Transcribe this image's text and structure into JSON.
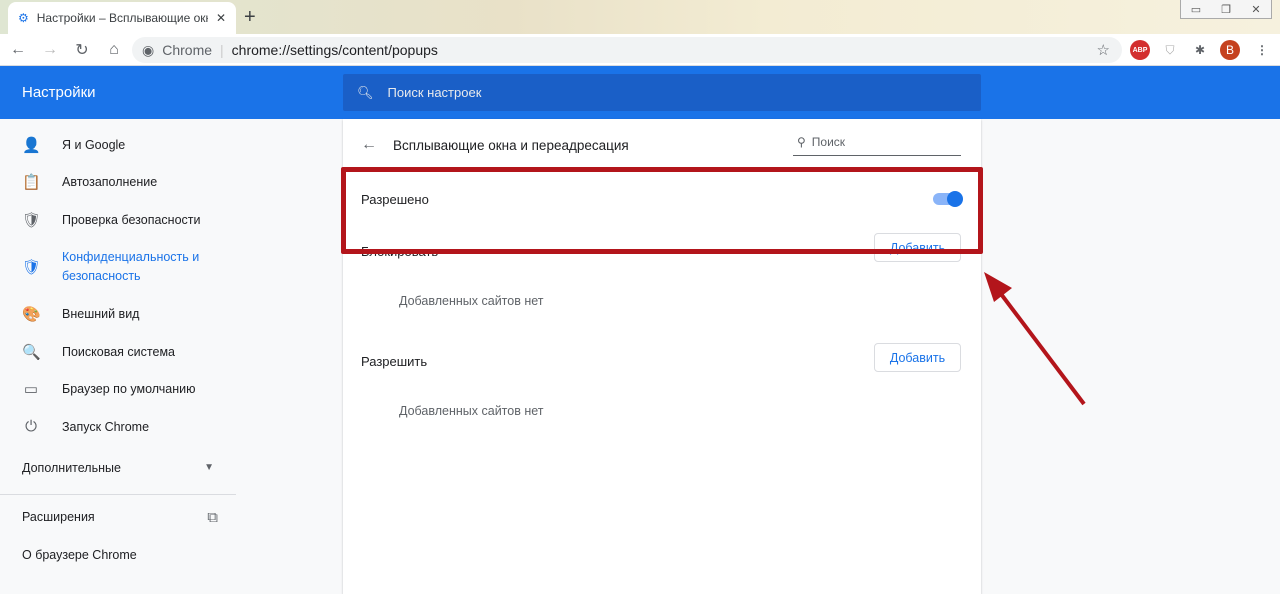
{
  "browser": {
    "tab_title": "Настройки – Всплывающие окна",
    "url_host": "Chrome",
    "url": "chrome://settings/content/popups",
    "avatar_letter": "B",
    "abp_label": "ABP"
  },
  "header": {
    "title": "Настройки",
    "search_placeholder": "Поиск настроек"
  },
  "sidebar": {
    "items": [
      {
        "label": "Я и Google",
        "icon": "👤"
      },
      {
        "label": "Автозаполнение",
        "icon": "📋"
      },
      {
        "label": "Проверка безопасности",
        "icon": "🛡"
      },
      {
        "label": "Конфиденциальность и безопасность",
        "icon": "🛡"
      },
      {
        "label": "Внешний вид",
        "icon": "🎨"
      },
      {
        "label": "Поисковая система",
        "icon": "🔍"
      },
      {
        "label": "Браузер по умолчанию",
        "icon": "▭"
      },
      {
        "label": "Запуск Chrome",
        "icon": "⏻"
      }
    ],
    "advanced": "Дополнительные",
    "extensions": "Расширения",
    "about": "О браузере Chrome"
  },
  "page": {
    "title": "Всплывающие окна и переадресация",
    "search_placeholder": "Поиск",
    "allowed_label": "Разрешено",
    "allowed_on": true,
    "block": {
      "label": "Блокировать",
      "add": "Добавить",
      "empty": "Добавленных сайтов нет"
    },
    "allow": {
      "label": "Разрешить",
      "add": "Добавить",
      "empty": "Добавленных сайтов нет"
    }
  },
  "colors": {
    "accent": "#1a73e8",
    "highlight": "#b3151b"
  }
}
